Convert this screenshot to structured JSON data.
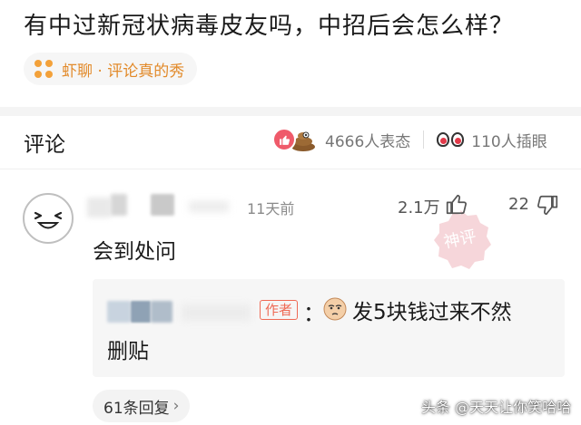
{
  "question": {
    "title": "有中过新冠状病毒皮友吗，中招后会怎么样？"
  },
  "tag": {
    "text": "虾聊 · 评论真的秀",
    "color": "#e28a2a"
  },
  "comments_header": {
    "title": "评论",
    "reactions_count": "4666人表态",
    "peek_count": "110人插眼"
  },
  "comment": {
    "time": "11天前",
    "like_count": "2.1万",
    "dislike_count": "22",
    "text": "会到处问",
    "stamp_text": "神评",
    "reply": {
      "author_badge": "作者",
      "colon": "：",
      "line1": "发5块钱过来不然",
      "line2": "删贴"
    },
    "replies_label": "61条回复",
    "replies_chevron": "›"
  },
  "watermark": "头条 @天天让你笑哈哈",
  "colors": {
    "accent": "#ef6a55",
    "like": "#ef5a6a"
  }
}
